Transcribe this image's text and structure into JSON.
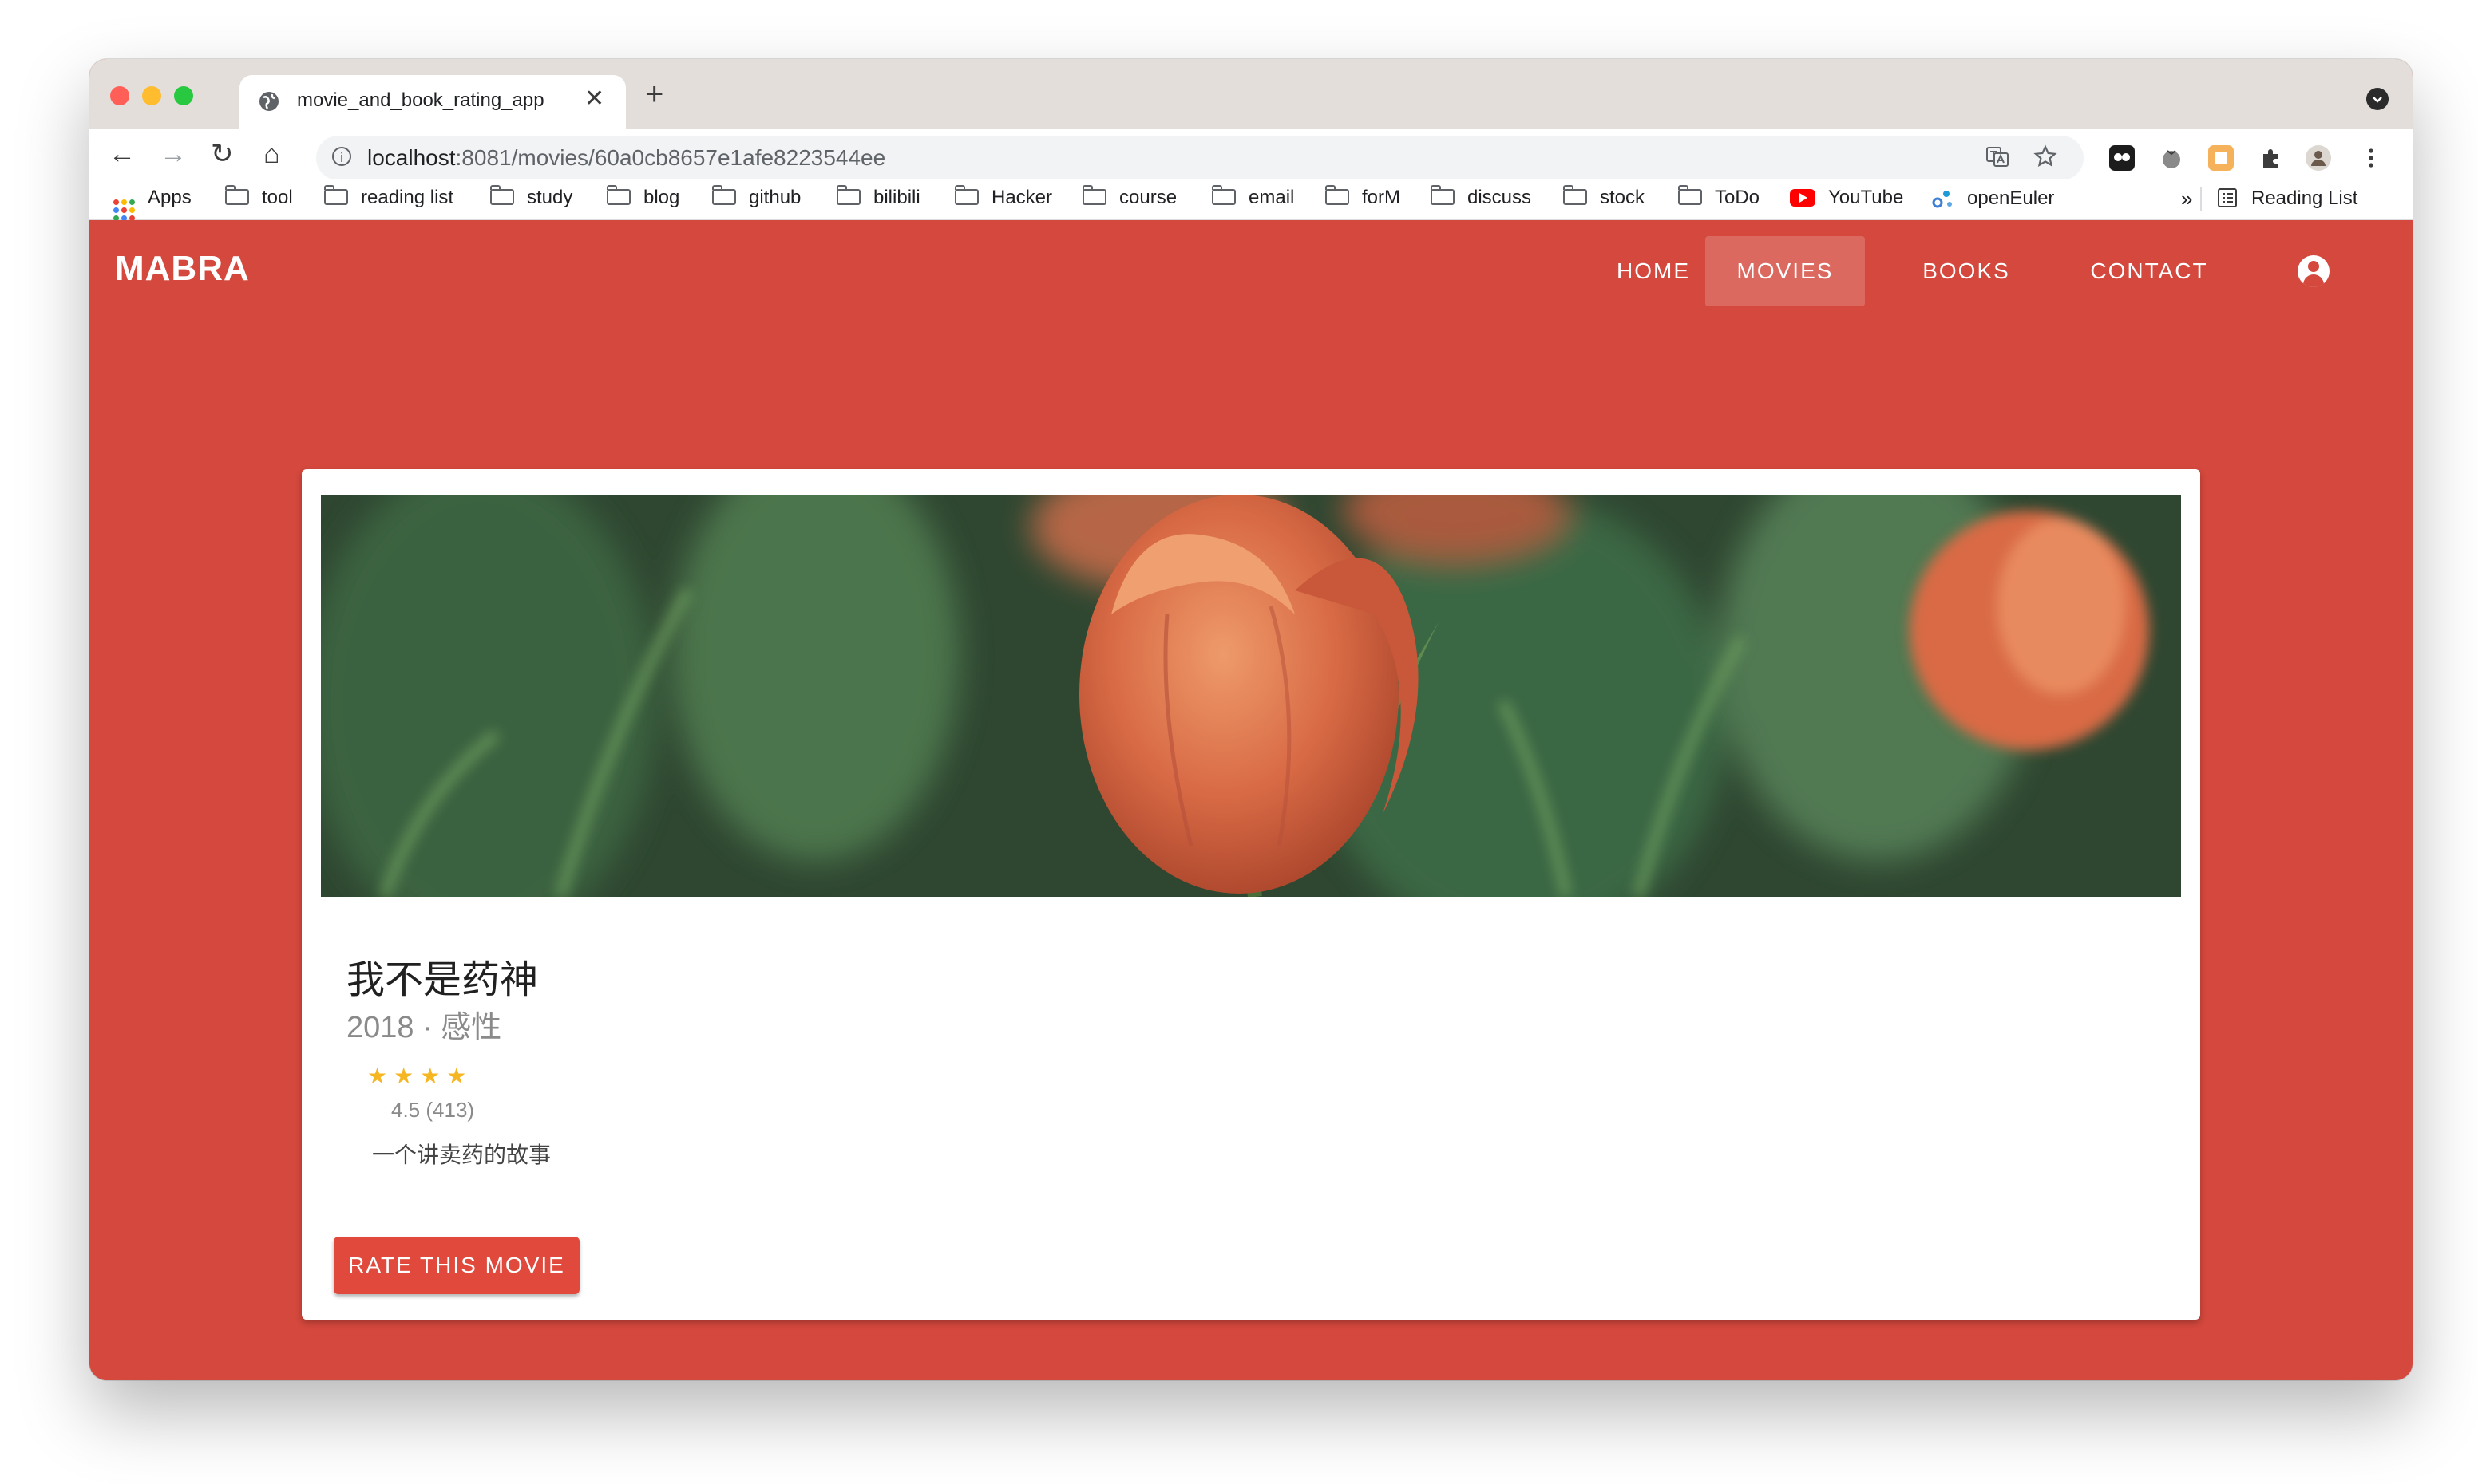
{
  "browser": {
    "tab_title": "movie_and_book_rating_app",
    "tab_close": "✕",
    "new_tab": "+",
    "nav": {
      "back": "←",
      "forward": "→",
      "reload": "↻",
      "home": "⌂"
    },
    "url_host": "localhost",
    "url_rest": ":8081/movies/60a0cb8657e1afe8223544ee",
    "bookmarks": [
      {
        "label": "Apps",
        "icon": "apps-grid-icon"
      },
      {
        "label": "tool",
        "icon": "folder-icon"
      },
      {
        "label": "reading list",
        "icon": "folder-icon"
      },
      {
        "label": "study",
        "icon": "folder-icon"
      },
      {
        "label": "blog",
        "icon": "folder-icon"
      },
      {
        "label": "github",
        "icon": "folder-icon"
      },
      {
        "label": "bilibili",
        "icon": "folder-icon"
      },
      {
        "label": "Hacker",
        "icon": "folder-icon"
      },
      {
        "label": "course",
        "icon": "folder-icon"
      },
      {
        "label": "email",
        "icon": "folder-icon"
      },
      {
        "label": "forM",
        "icon": "folder-icon"
      },
      {
        "label": "discuss",
        "icon": "folder-icon"
      },
      {
        "label": "stock",
        "icon": "folder-icon"
      },
      {
        "label": "ToDo",
        "icon": "folder-icon"
      },
      {
        "label": "YouTube",
        "icon": "youtube-icon"
      },
      {
        "label": "openEuler",
        "icon": "openeuler-icon"
      }
    ],
    "bookmarks_overflow": "»",
    "reading_list": "Reading List"
  },
  "app": {
    "brand": "MABRA",
    "nav": [
      {
        "label": "HOME",
        "active": false
      },
      {
        "label": "MOVIES",
        "active": true
      },
      {
        "label": "BOOKS",
        "active": false
      },
      {
        "label": "CONTACT",
        "active": false
      }
    ],
    "movie": {
      "title": "我不是药神",
      "year_genre": "2018 · 感性",
      "stars": "★★★★",
      "rating": "4.5 (413)",
      "description": "一个讲卖药的故事",
      "rate_button": "RATE THIS MOVIE"
    }
  },
  "colors": {
    "primary": "#d4483d",
    "active_nav": "#dc6960",
    "button": "#e0493c",
    "star": "#f5b622"
  }
}
